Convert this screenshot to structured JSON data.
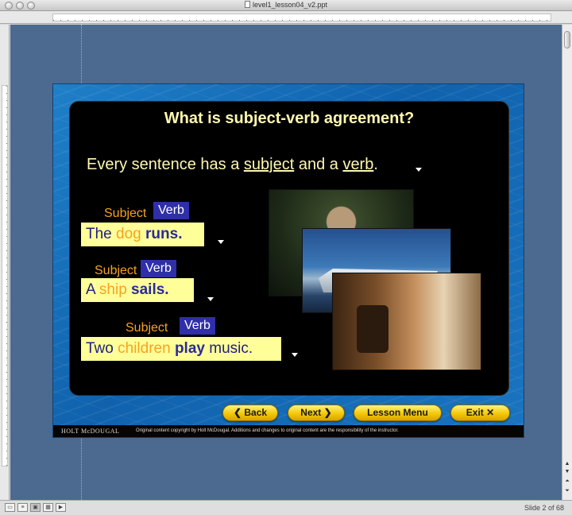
{
  "window": {
    "title": "level1_lesson04_v2.ppt"
  },
  "slide": {
    "title": "What is subject-verb agreement?",
    "intro": {
      "prefix": "Every sentence has a ",
      "subject_word": "subject",
      "middle": " and a ",
      "verb_word": "verb",
      "suffix": "."
    },
    "examples": [
      {
        "subject_tag": "Subject",
        "verb_tag": "Verb",
        "article": "The ",
        "subject": "dog",
        "space": " ",
        "verb": "runs.",
        "rest": ""
      },
      {
        "subject_tag": "Subject",
        "verb_tag": "Verb",
        "article": "A ",
        "subject": "ship",
        "space": " ",
        "verb": "sails.",
        "rest": ""
      },
      {
        "subject_tag": "Subject",
        "verb_tag": "Verb",
        "article": "Two ",
        "subject": "children",
        "space": " ",
        "verb": "play",
        "rest": " music."
      }
    ],
    "photos": [
      "dog-photo",
      "ship-photo",
      "children-music-photo"
    ],
    "nav": {
      "back": "Back",
      "next": "Next",
      "menu": "Lesson Menu",
      "exit": "Exit"
    },
    "footer": {
      "logo": "HOLT McDOUGAL",
      "copyright": "Original content copyright by Holt McDougal. Additions and changes to original content are the responsibility of the instructor."
    }
  },
  "status": {
    "slide_count": "Slide 2 of 68"
  },
  "colors": {
    "workspace": "#4c6a90",
    "title_yellow": "#fff8b0",
    "subject_orange": "#f5a320",
    "verb_blue": "#2f2fa8",
    "sentence_bg": "#ffff99"
  }
}
